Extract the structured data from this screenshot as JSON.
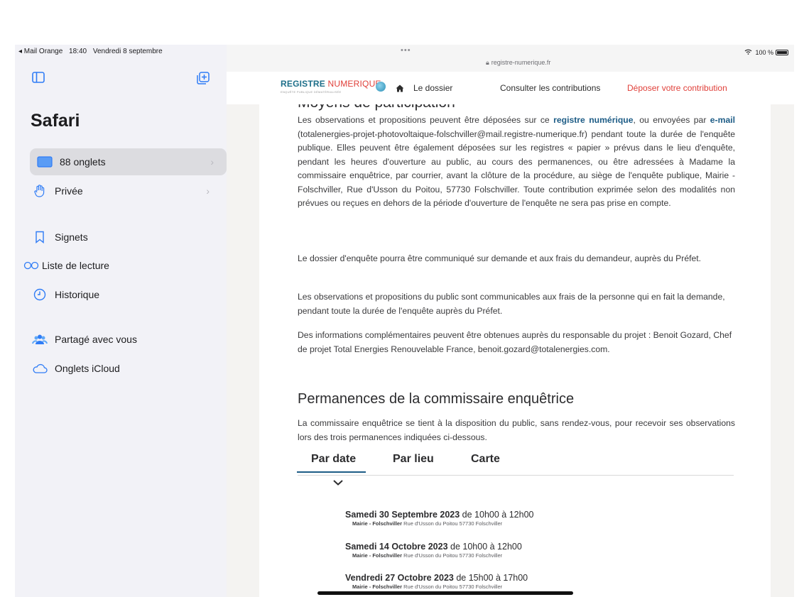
{
  "status_bar": {
    "back_app": "◂ Mail Orange",
    "time": "18:40",
    "date": "Vendredi 8 septembre",
    "battery": "100 %"
  },
  "sidebar": {
    "title": "Safari",
    "items": [
      {
        "label": "88 onglets",
        "icon": "tabs-icon",
        "chevron": "›"
      },
      {
        "label": "Privée",
        "icon": "hand-icon",
        "chevron": "›"
      },
      {
        "label": "Signets",
        "icon": "bookmark-icon"
      },
      {
        "label": "Liste de lecture",
        "icon": "reading-list-icon"
      },
      {
        "label": "Historique",
        "icon": "clock-icon"
      },
      {
        "label": "Partagé avec vous",
        "icon": "shared-icon"
      },
      {
        "label": "Onglets iCloud",
        "icon": "cloud-icon"
      }
    ]
  },
  "browser": {
    "dots": "•••",
    "url": "registre-numerique.fr"
  },
  "site": {
    "logo_part1": "REGISTRE",
    "logo_part2": "NUMERIQUE",
    "logo_sub": "ENQUÊTE PUBLIQUE DÉMATÉRIALISÉE",
    "nav": [
      "Le dossier",
      "Consulter les contributions",
      "Déposer votre contribution"
    ]
  },
  "page": {
    "clipped_heading": "Moyens de participation",
    "para1_a": "Les observations et propositions peuvent être déposées sur ce ",
    "para1_link": "registre numérique",
    "para1_b": ", ou envoyées par ",
    "para1_email": "e-mail",
    "para1_c": " (totalenergies-projet-photovoltaique-folschviller@mail.registre-numerique.fr) pendant toute la durée de l'enquête publique. Elles peuvent être également déposées sur les registres « papier » prévus dans le lieu d'enquête, pendant les heures d'ouverture au public, au cours des permanences, ou être adressées à Madame la commissaire enquêtrice, par courrier, avant la clôture de la procédure, au siège de l'enquête publique, Mairie - Folschviller, Rue d'Usson du Poitou, 57730 Folschviller. Toute contribution exprimée selon des modalités non prévues ou reçues en dehors de la période d'ouverture de l'enquête ne sera pas prise en compte.",
    "para2": "Le dossier d'enquête pourra être communiqué sur demande et aux frais du demandeur, auprès du Préfet.",
    "para3": "Les observations et propositions du public sont communicables aux frais de la personne qui en fait la demande, pendant toute la durée de l'enquête auprès du Préfet.",
    "para4": "Des informations complémentaires peuvent être obtenues auprès du responsable du projet : Benoit Gozard, Chef de projet Total Energies Renouvelable France, benoit.gozard@totalenergies.com.",
    "perm_title": "Permanences de la commissaire enquêtrice",
    "perm_text": "La commissaire enquêtrice se tient à la disposition du public, sans rendez-vous, pour recevoir ses observations lors des trois permanences indiquées ci-dessous.",
    "tabs": [
      "Par date",
      "Par lieu",
      "Carte"
    ],
    "events": [
      {
        "date": "Samedi 30 Septembre 2023",
        "hours": " de 10h00 à 12h00",
        "place_name": "Mairie - Folschviller",
        "place_addr": " Rue d'Usson du Poitou 57730 Folschviller"
      },
      {
        "date": "Samedi 14 Octobre 2023",
        "hours": " de 10h00 à 12h00",
        "place_name": "Mairie - Folschviller",
        "place_addr": " Rue d'Usson du Poitou 57730 Folschviller"
      },
      {
        "date": "Vendredi 27 Octobre 2023",
        "hours": " de 15h00 à 17h00",
        "place_name": "Mairie - Folschviller",
        "place_addr": " Rue d'Usson du Poitou 57730 Folschviller"
      }
    ]
  }
}
